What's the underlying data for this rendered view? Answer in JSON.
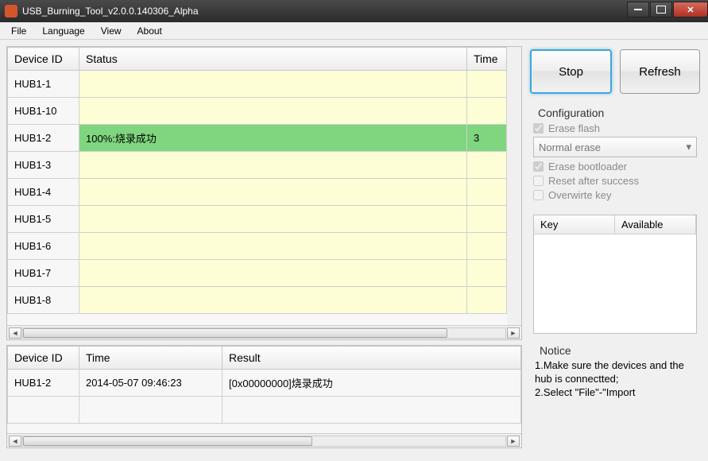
{
  "window": {
    "title": "USB_Burning_Tool_v2.0.0.140306_Alpha"
  },
  "menu": {
    "file": "File",
    "language": "Language",
    "view": "View",
    "about": "About"
  },
  "topTable": {
    "headers": {
      "deviceId": "Device ID",
      "status": "Status",
      "time": "Time"
    },
    "rows": [
      {
        "deviceId": "HUB1-1",
        "status": "",
        "time": "",
        "success": false
      },
      {
        "deviceId": "HUB1-10",
        "status": "",
        "time": "",
        "success": false
      },
      {
        "deviceId": "HUB1-2",
        "status": "100%:烧录成功",
        "time": "3",
        "success": true
      },
      {
        "deviceId": "HUB1-3",
        "status": "",
        "time": "",
        "success": false
      },
      {
        "deviceId": "HUB1-4",
        "status": "",
        "time": "",
        "success": false
      },
      {
        "deviceId": "HUB1-5",
        "status": "",
        "time": "",
        "success": false
      },
      {
        "deviceId": "HUB1-6",
        "status": "",
        "time": "",
        "success": false
      },
      {
        "deviceId": "HUB1-7",
        "status": "",
        "time": "",
        "success": false
      },
      {
        "deviceId": "HUB1-8",
        "status": "",
        "time": "",
        "success": false
      }
    ]
  },
  "bottomTable": {
    "headers": {
      "deviceId": "Device ID",
      "time": "Time",
      "result": "Result"
    },
    "rows": [
      {
        "deviceId": "HUB1-2",
        "time": "2014-05-07 09:46:23",
        "result": "[0x00000000]烧录成功"
      }
    ]
  },
  "buttons": {
    "stop": "Stop",
    "refresh": "Refresh"
  },
  "config": {
    "title": "Configuration",
    "eraseFlash": "Erase flash",
    "eraseMode": "Normal erase",
    "eraseBootloader": "Erase bootloader",
    "resetAfter": "Reset after success",
    "overwriteKey": "Overwirte key"
  },
  "keyTable": {
    "key": "Key",
    "available": "Available"
  },
  "notice": {
    "title": "Notice",
    "line1": "1.Make sure the devices and the hub is connectted;",
    "line2": "2.Select \"File\"-\"Import"
  }
}
